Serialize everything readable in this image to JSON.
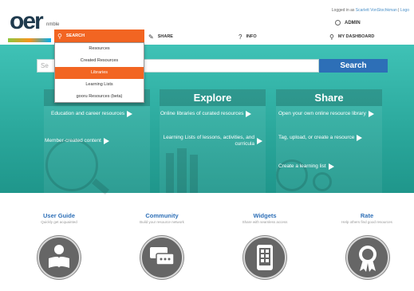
{
  "brand": {
    "logo_text": "oer",
    "logo_sub": "nmble"
  },
  "header": {
    "login_prefix": "Logged in as",
    "login_user": "Scarlett VonStochkman",
    "login_separator": "|",
    "login_action": "Logo",
    "admin_label": "ADMIN"
  },
  "nav": {
    "search_label": "SEARCH",
    "share_label": "SHARE",
    "info_label": "INFO",
    "dashboard_label": "MY DASHBOARD"
  },
  "dropdown": {
    "items": [
      "Resources",
      "Created Resources",
      "Libraries",
      "Learning Lists",
      "gooru Resources (beta)"
    ],
    "active": "Libraries"
  },
  "search": {
    "placeholder": "Se",
    "button_label": "Search"
  },
  "panels": [
    {
      "title": "Learn",
      "lines": [
        "Education and career resources",
        "Member-created content"
      ]
    },
    {
      "title": "Explore",
      "lines": [
        "Online libraries of curated resources",
        "Learning Lists of lessons, activities, and curricula"
      ]
    },
    {
      "title": "Share",
      "lines": [
        "Open your own online resource library",
        "Tag, upload, or create a resource",
        "Create a learning list"
      ]
    }
  ],
  "features": [
    {
      "title": "User Guide",
      "subtitle": "Quickly get acquainted",
      "icon": "reader-icon"
    },
    {
      "title": "Community",
      "subtitle": "Build your resource network",
      "icon": "chat-bubbles-icon"
    },
    {
      "title": "Widgets",
      "subtitle": "Share with seamless access",
      "icon": "tablet-icon"
    },
    {
      "title": "Rate",
      "subtitle": "Help others find good resources",
      "icon": "award-ribbon-icon"
    }
  ],
  "colors": {
    "orange": "#f26522",
    "teal": "#2aa79b",
    "blue": "#2d6fb7",
    "icon_gray": "#666666"
  }
}
